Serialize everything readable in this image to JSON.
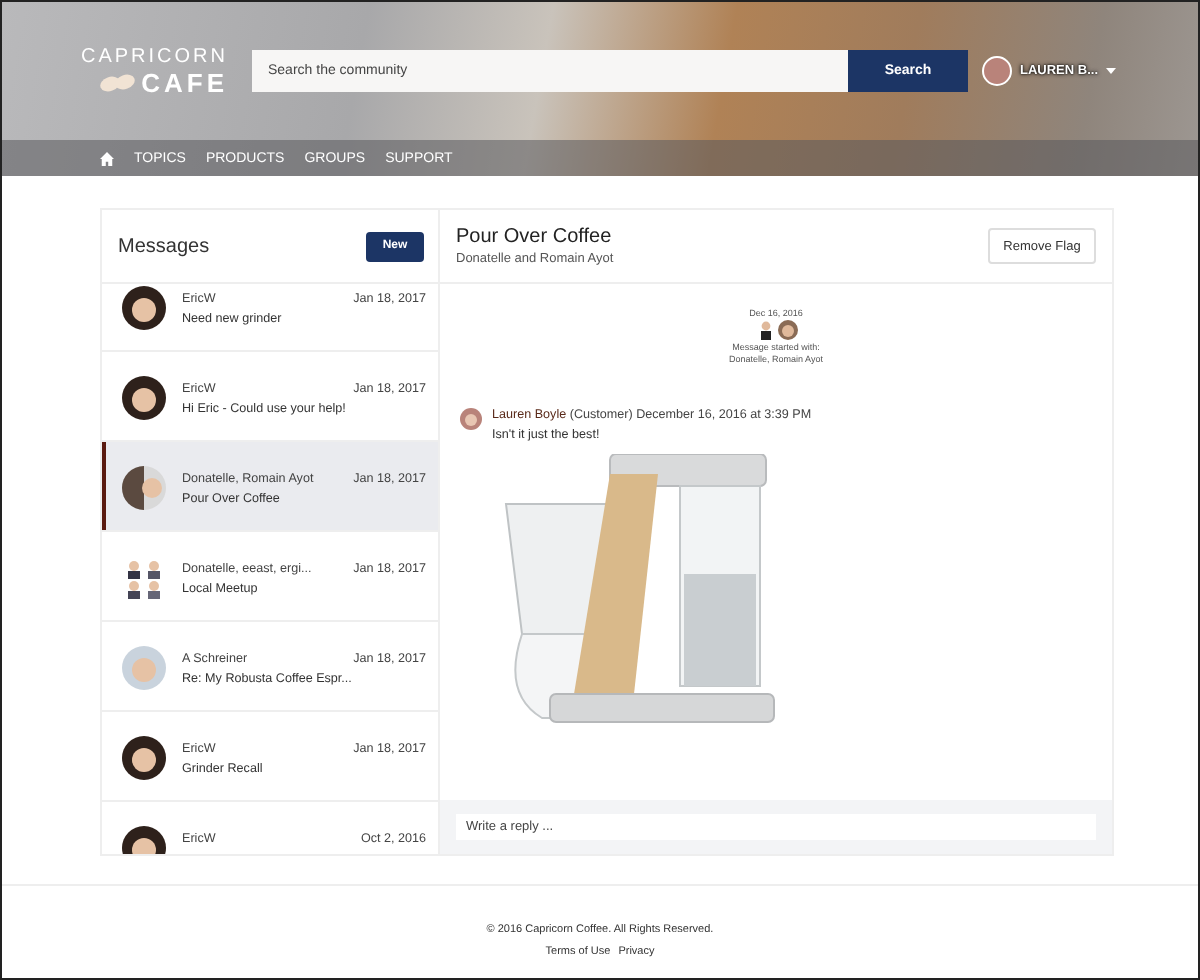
{
  "header": {
    "logo": {
      "line_1": "CAPRICORN",
      "line_2": "CAFE"
    },
    "search": {
      "placeholder": "Search the community",
      "button": "Search"
    },
    "user": {
      "name": "LAUREN B..."
    }
  },
  "nav": {
    "items": [
      {
        "label": "TOPICS"
      },
      {
        "label": "PRODUCTS"
      },
      {
        "label": "GROUPS"
      },
      {
        "label": "SUPPORT"
      }
    ]
  },
  "messages": {
    "title": "Messages",
    "new_button": "New",
    "items": [
      {
        "kind": "single",
        "sender": "EricW",
        "subject": "Need new grinder",
        "date": "Jan 18, 2017",
        "selected": false
      },
      {
        "kind": "single",
        "sender": "EricW",
        "subject": "Hi Eric - Could use your help!",
        "date": "Jan 18, 2017",
        "selected": false
      },
      {
        "kind": "pair",
        "sender": "Donatelle, Romain Ayot",
        "subject": "Pour Over Coffee",
        "date": "Jan 18, 2017",
        "selected": true
      },
      {
        "kind": "group",
        "sender": "Donatelle, eeast, ergi...",
        "subject": "Local Meetup",
        "date": "Jan 18, 2017",
        "selected": false
      },
      {
        "kind": "single",
        "sender": "A Schreiner",
        "subject": "Re: My Robusta Coffee Espr...",
        "date": "Jan 18, 2017",
        "selected": false
      },
      {
        "kind": "single",
        "sender": "EricW",
        "subject": "Grinder Recall",
        "date": "Jan 18, 2017",
        "selected": false
      },
      {
        "kind": "single",
        "sender": "EricW",
        "date": "Oct 2, 2016",
        "selected": false
      }
    ]
  },
  "thread": {
    "title": "Pour Over Coffee",
    "participants": "Donatelle and Romain Ayot",
    "flag_button": "Remove Flag",
    "started": {
      "date": "Dec 16, 2016",
      "text": "Message started with:",
      "names": "Donatelle, Romain Ayot"
    },
    "post": {
      "author": "Lauren Boyle",
      "role": "(Customer)",
      "time": "December 16, 2016 at 3:39 PM",
      "body": "Isn't it just the best!"
    },
    "reply": {
      "placeholder": "Write a reply ..."
    }
  },
  "footer": {
    "copyright": "© 2016 Capricorn Coffee. All Rights Reserved.",
    "links": [
      "Terms of Use",
      "Privacy"
    ]
  }
}
